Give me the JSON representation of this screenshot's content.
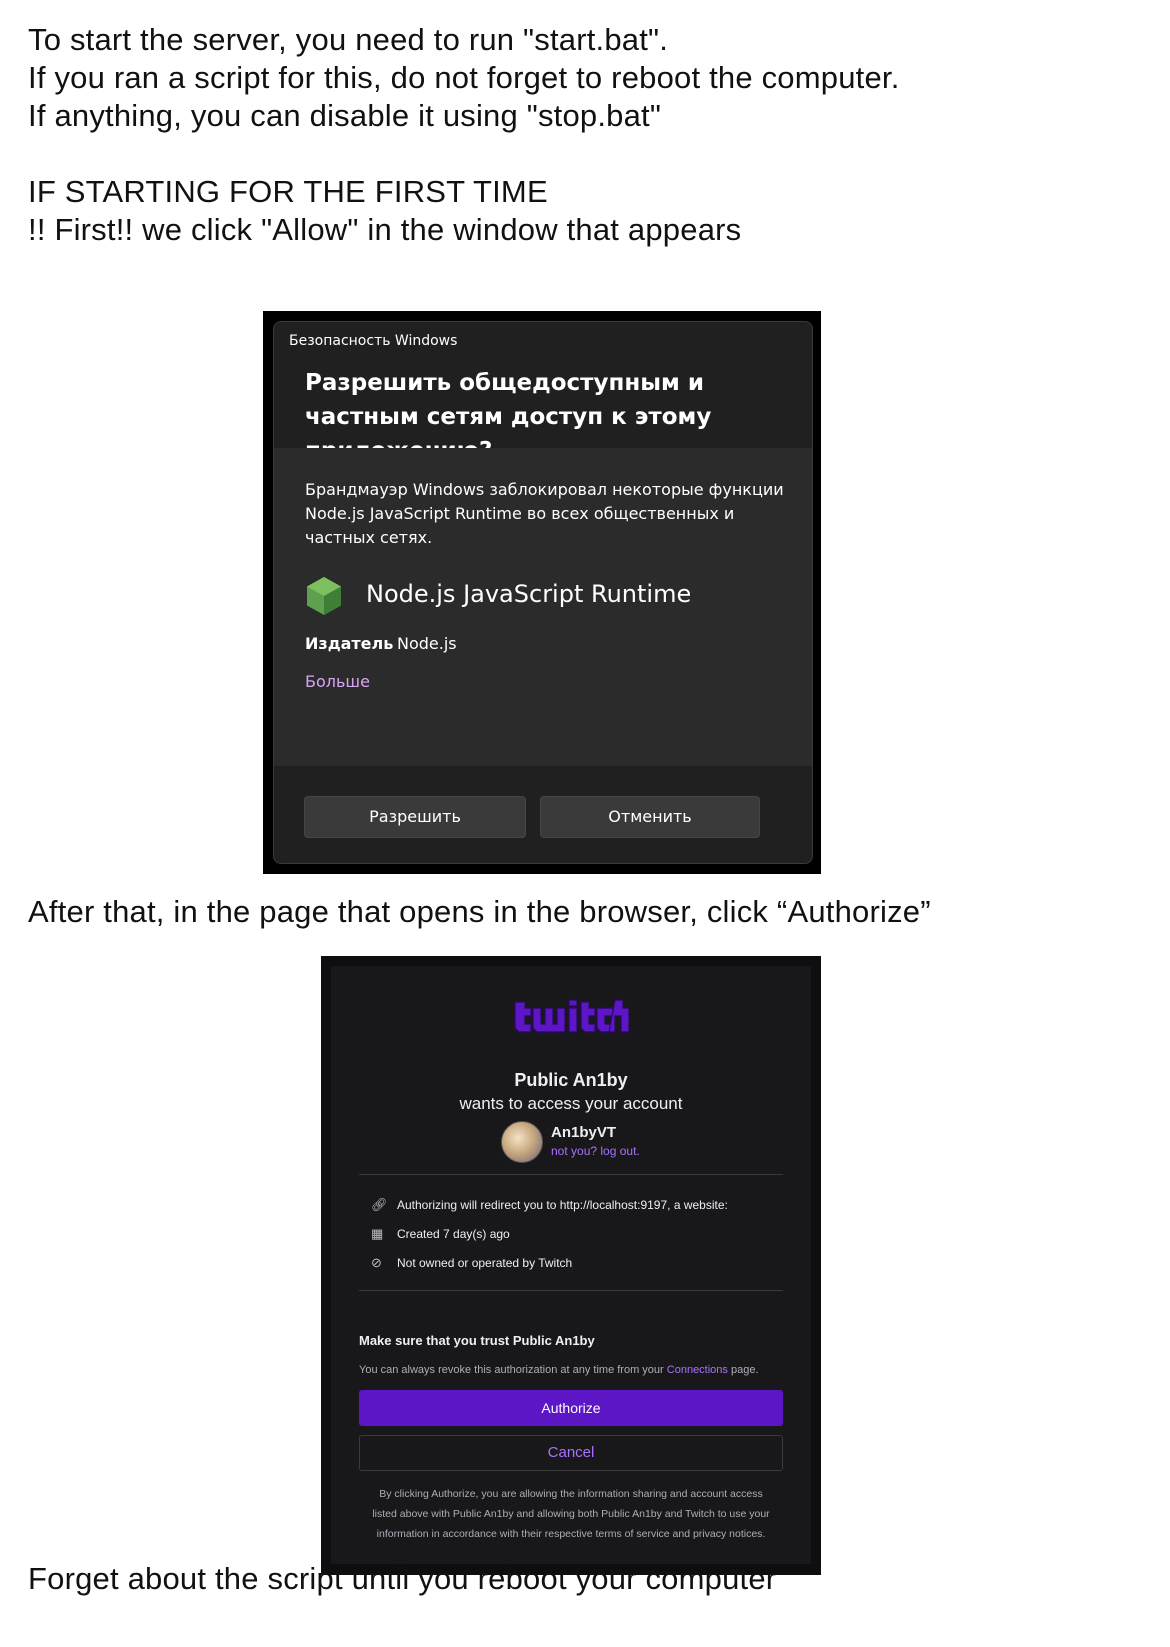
{
  "instructions": {
    "line1": "To start the server, you need to run \"start.bat\".",
    "line2": "If you ran a script for this, do not forget to reboot the computer.",
    "line3": "If anything, you can disable it using \"stop.bat\"",
    "line4": "IF STARTING FOR THE FIRST TIME",
    "line5": "!! First!! we click \"Allow\" in the window that appears",
    "line6": "After that, in the page that opens in the browser, click “Authorize”",
    "line7": "Forget about the script until you reboot your computer"
  },
  "windows_dialog": {
    "caption": "Безопасность Windows",
    "title": "Разрешить общедоступным и частным сетям доступ к этому приложению?",
    "description": "Брандмауэр Windows заблокировал некоторые функции Node.js JavaScript Runtime во всех общественных и частных сетях.",
    "app_name": "Node.js JavaScript Runtime",
    "app_icon": "nodejs-hexagon-icon",
    "publisher_label": "Издатель",
    "publisher_value": "Node.js",
    "more_link": "Больше",
    "allow_button": "Разрешить",
    "cancel_button": "Отменить"
  },
  "twitch_auth": {
    "logo": "twitch-logo",
    "app_name": "Public An1by",
    "subtitle": "wants to access your account",
    "username": "An1byVT",
    "logout_link": "not you? log out.",
    "info_rows": [
      {
        "icon": "link-icon",
        "text": "Authorizing will redirect you to http://localhost:9197, a website:"
      },
      {
        "icon": "calendar-icon",
        "text": "Created 7 day(s) ago"
      },
      {
        "icon": "not-allowed-icon",
        "text": "Not owned or operated by Twitch"
      }
    ],
    "trust_heading": "Make sure that you trust Public An1by",
    "revoke_before": "You can always revoke this authorization at any time from your",
    "revoke_link": "Connections",
    "revoke_after": "page.",
    "authorize_button": "Authorize",
    "cancel_button": "Cancel",
    "legal_line1": "By clicking Authorize, you are allowing the information sharing and account access",
    "legal_line2": "listed above with Public An1by and allowing both Public An1by and Twitch to use your",
    "legal_line3": "information in accordance with their respective terms of service and privacy notices.",
    "colors": {
      "brand": "#9146ff",
      "authorize_bg": "#5c16c5",
      "link": "#a970ff",
      "panel_bg": "#18181b"
    }
  }
}
